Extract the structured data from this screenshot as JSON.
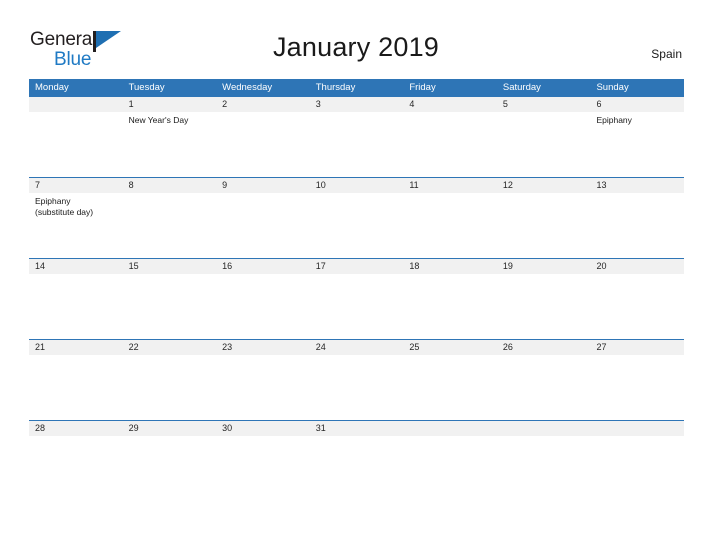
{
  "brand": {
    "name_part1": "General",
    "name_part2": "Blue",
    "flag_icon": "flag-icon",
    "primary_color": "#1f7ac4"
  },
  "header": {
    "title": "January 2019",
    "country": "Spain"
  },
  "theme": {
    "header_blue": "#2e75b6",
    "date_band_gray": "#f1f1f1",
    "text_dark": "#1a1a1a",
    "page_background": "#ffffff"
  },
  "calendar": {
    "month": "January",
    "year": "2019",
    "weekdays": [
      "Monday",
      "Tuesday",
      "Wednesday",
      "Thursday",
      "Friday",
      "Saturday",
      "Sunday"
    ],
    "weeks": [
      {
        "dates": [
          "",
          "1",
          "2",
          "3",
          "4",
          "5",
          "6"
        ],
        "events": [
          "",
          "New Year's Day",
          "",
          "",
          "",
          "",
          "Epiphany"
        ]
      },
      {
        "dates": [
          "7",
          "8",
          "9",
          "10",
          "11",
          "12",
          "13"
        ],
        "events": [
          "Epiphany\n(substitute day)",
          "",
          "",
          "",
          "",
          "",
          ""
        ]
      },
      {
        "dates": [
          "14",
          "15",
          "16",
          "17",
          "18",
          "19",
          "20"
        ],
        "events": [
          "",
          "",
          "",
          "",
          "",
          "",
          ""
        ]
      },
      {
        "dates": [
          "21",
          "22",
          "23",
          "24",
          "25",
          "26",
          "27"
        ],
        "events": [
          "",
          "",
          "",
          "",
          "",
          "",
          ""
        ]
      },
      {
        "dates": [
          "28",
          "29",
          "30",
          "31",
          "",
          "",
          ""
        ],
        "events": [
          "",
          "",
          "",
          "",
          "",
          "",
          ""
        ]
      }
    ]
  }
}
